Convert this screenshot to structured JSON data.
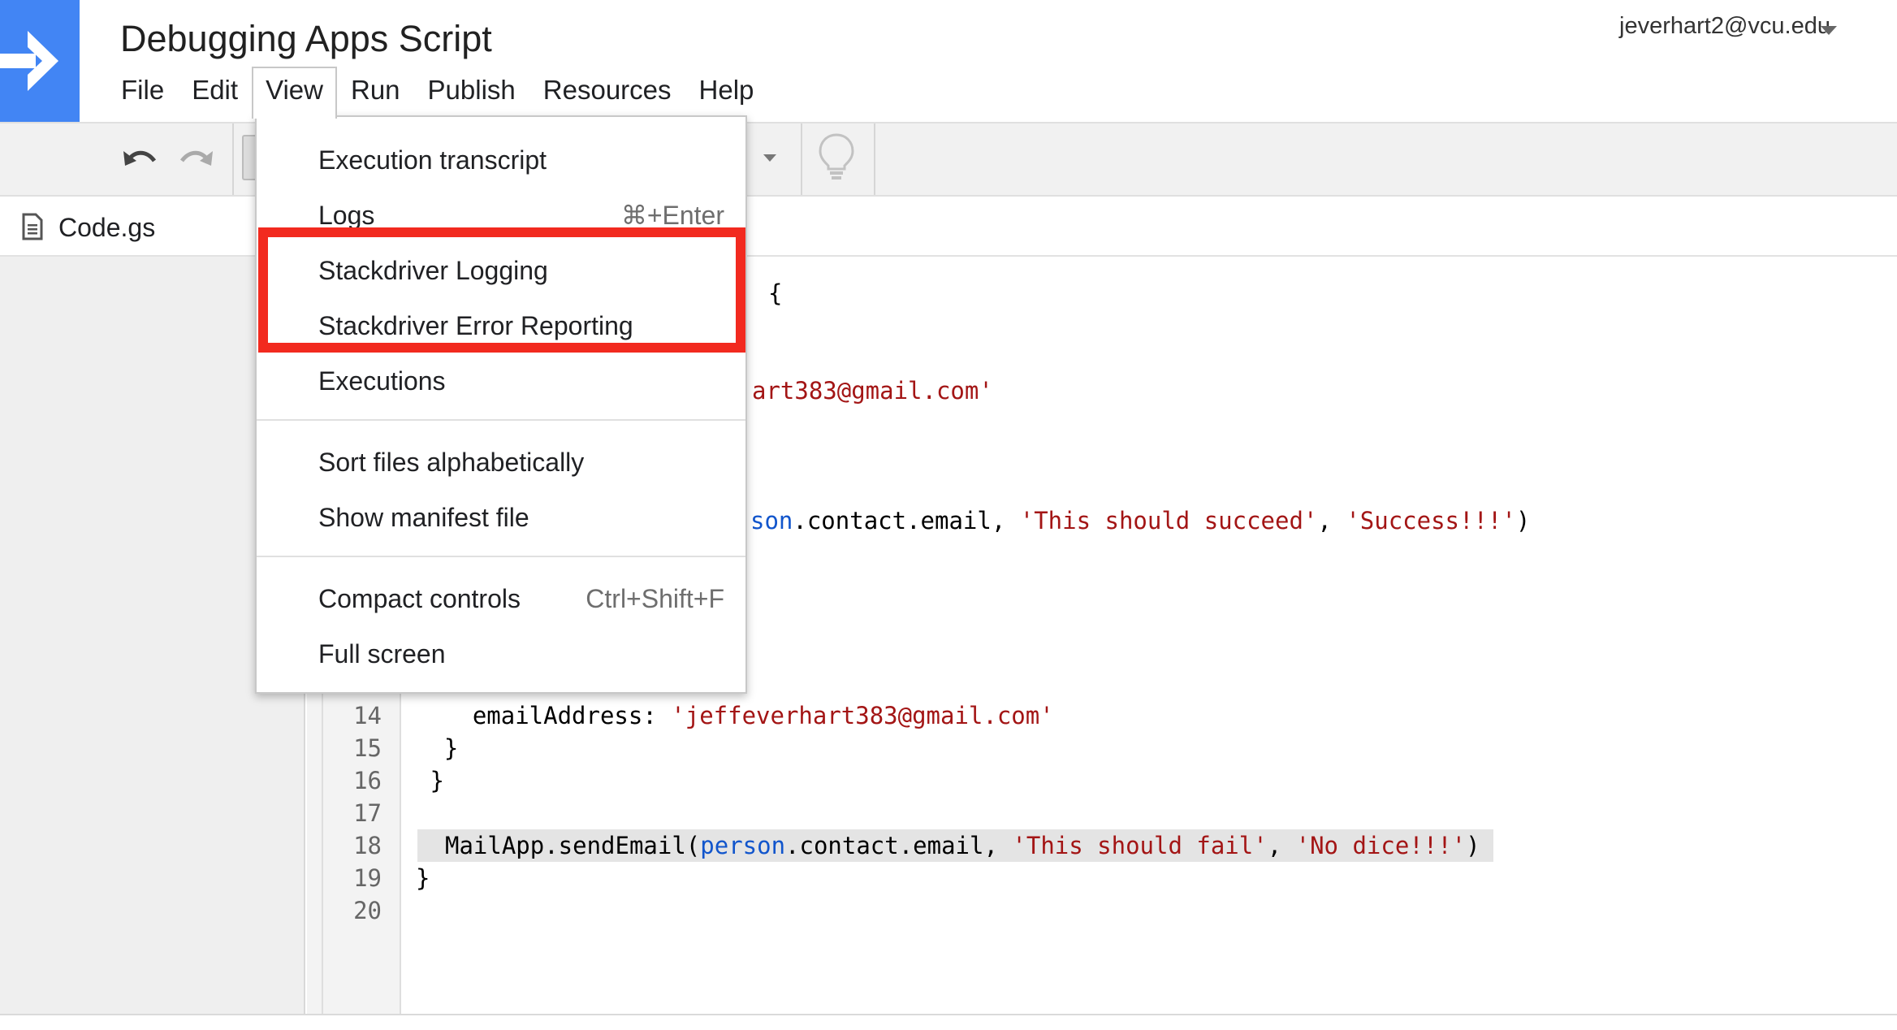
{
  "app": {
    "title": "Debugging Apps Script",
    "account": "jeverhart2@vcu.edu"
  },
  "menubar": [
    "File",
    "Edit",
    "View",
    "Run",
    "Publish",
    "Resources",
    "Help"
  ],
  "view_menu": {
    "items": [
      {
        "label": "Execution transcript",
        "shortcut": ""
      },
      {
        "label": "Logs",
        "shortcut": "⌘+Enter"
      },
      {
        "label": "Stackdriver Logging",
        "shortcut": ""
      },
      {
        "label": "Stackdriver Error Reporting",
        "shortcut": ""
      },
      {
        "label": "Executions",
        "shortcut": ""
      },
      {
        "label": "Sort files alphabetically",
        "shortcut": ""
      },
      {
        "label": "Show manifest file",
        "shortcut": ""
      },
      {
        "label": "Compact controls",
        "shortcut": "Ctrl+Shift+F"
      },
      {
        "label": "Full screen",
        "shortcut": ""
      }
    ],
    "highlight_color": "#f22a1f"
  },
  "files": [
    {
      "name": "Code.gs"
    }
  ],
  "editor": {
    "line_numbers": [
      "14",
      "15",
      "16",
      "17",
      "18",
      "19",
      "20"
    ],
    "fragments": {
      "brace": "{",
      "email_tail": "art383@gmail.com'",
      "line_succeed_var": "son",
      "line_succeed_mid": ".contact.email, ",
      "line_succeed_s1": "'This should succeed'",
      "line_succeed_comma": ", ",
      "line_succeed_s2": "'Success!!!'",
      "line_succeed_end": ")"
    },
    "lines": {
      "l14_key": "    emailAddress: ",
      "l14_val": "'jeffeverhart383@gmail.com'",
      "l15": "  }",
      "l16": " }",
      "l18_pre": "MailApp.sendEmail(",
      "l18_var": "person",
      "l18_mid": ".contact.email, ",
      "l18_s1": "'This should fail'",
      "l18_comma": ", ",
      "l18_s2": "'No dice!!!'",
      "l18_end": ")",
      "l19": "}"
    }
  },
  "colors": {
    "logo": "#4285f4",
    "string": "#a31515",
    "variable": "#1155cc"
  },
  "icons": [
    "arrow-right-icon",
    "undo-icon",
    "redo-icon",
    "dropdown-caret-icon",
    "lightbulb-icon",
    "file-icon"
  ]
}
